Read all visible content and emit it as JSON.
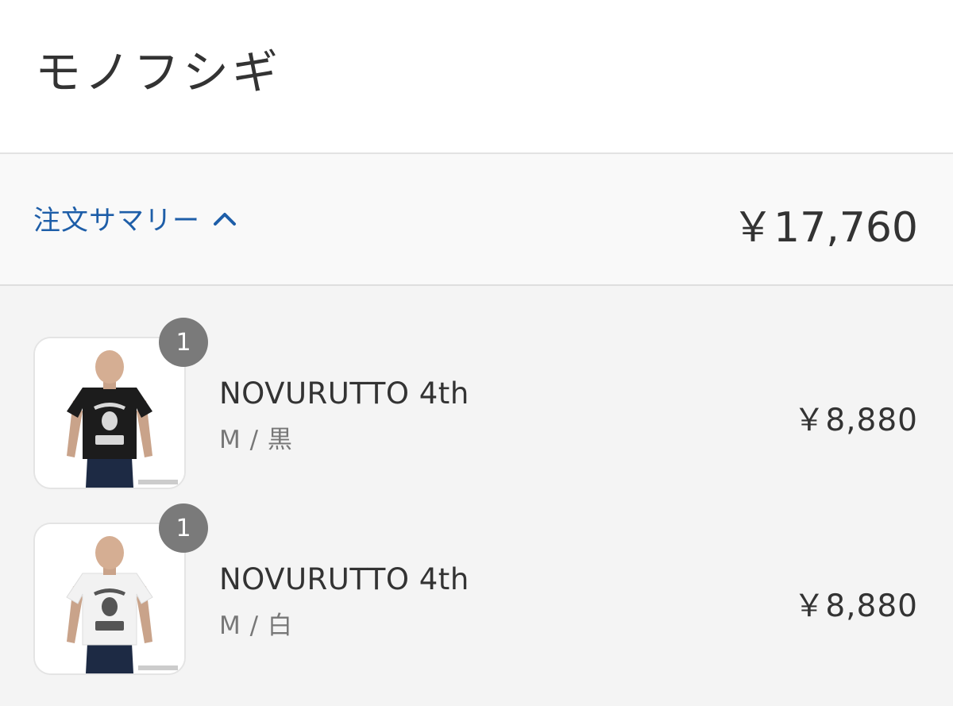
{
  "shop": {
    "title": "モノフシギ"
  },
  "summary": {
    "toggle_label": "注文サマリー",
    "toggle_icon": "chevron-up-icon",
    "total": "￥17,760"
  },
  "items": [
    {
      "quantity": "1",
      "name": "NOVURUTTO 4th",
      "variant": "M / 黒",
      "price": "￥8,880",
      "shirt_color": "#1c1c1c",
      "print_color": "#d8d8d8"
    },
    {
      "quantity": "1",
      "name": "NOVURUTTO 4th",
      "variant": "M / 白",
      "price": "￥8,880",
      "shirt_color": "#f2f2f2",
      "print_color": "#555555"
    }
  ],
  "colors": {
    "accent": "#1e5ea8",
    "badge": "#7a7a7a"
  }
}
